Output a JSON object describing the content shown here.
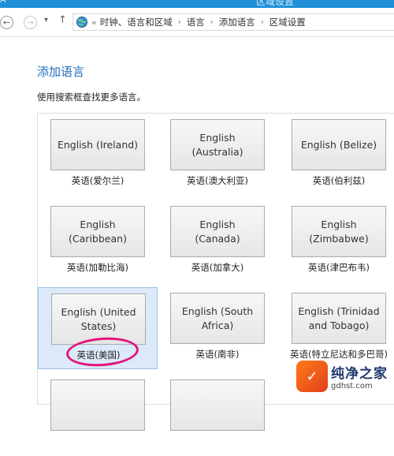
{
  "window": {
    "title": "区域设置",
    "left_fragment": "A"
  },
  "nav": {
    "back_glyph": "←",
    "forward_glyph": "→",
    "dropdown_glyph": "▾",
    "up_glyph": "↑",
    "breadcrumb_prefix": "«",
    "breadcrumb_sep": "›",
    "breadcrumbs": [
      "时钟、语言和区域",
      "语言",
      "添加语言",
      "区域设置"
    ]
  },
  "page": {
    "heading": "添加语言",
    "subtitle": "使用搜索框查找更多语言。"
  },
  "languages": [
    {
      "button": "English (Ireland)",
      "caption": "英语(爱尔兰)",
      "selected": false
    },
    {
      "button": "English (Australia)",
      "caption": "英语(澳大利亚)",
      "selected": false
    },
    {
      "button": "English (Belize)",
      "caption": "英语(伯利兹)",
      "selected": false
    },
    {
      "button": "English (Caribbean)",
      "caption": "英语(加勒比海)",
      "selected": false
    },
    {
      "button": "English (Canada)",
      "caption": "英语(加拿大)",
      "selected": false
    },
    {
      "button": "English (Zimbabwe)",
      "caption": "英语(津巴布韦)",
      "selected": false
    },
    {
      "button": "English (United States)",
      "caption": "英语(美国)",
      "selected": true
    },
    {
      "button": "English (South Africa)",
      "caption": "英语(南非)",
      "selected": false
    },
    {
      "button": "English (Trinidad and Tobago)",
      "caption": "英语(特立尼达和多巴哥)",
      "selected": false
    }
  ],
  "watermark": {
    "text": "纯净之家",
    "url": "gdhst.com"
  },
  "colors": {
    "heading": "#1e6fc1",
    "selected_bg": "#dbe9f8",
    "highlight_circle": "#e4147a",
    "titlebar": "#1e90d8"
  }
}
